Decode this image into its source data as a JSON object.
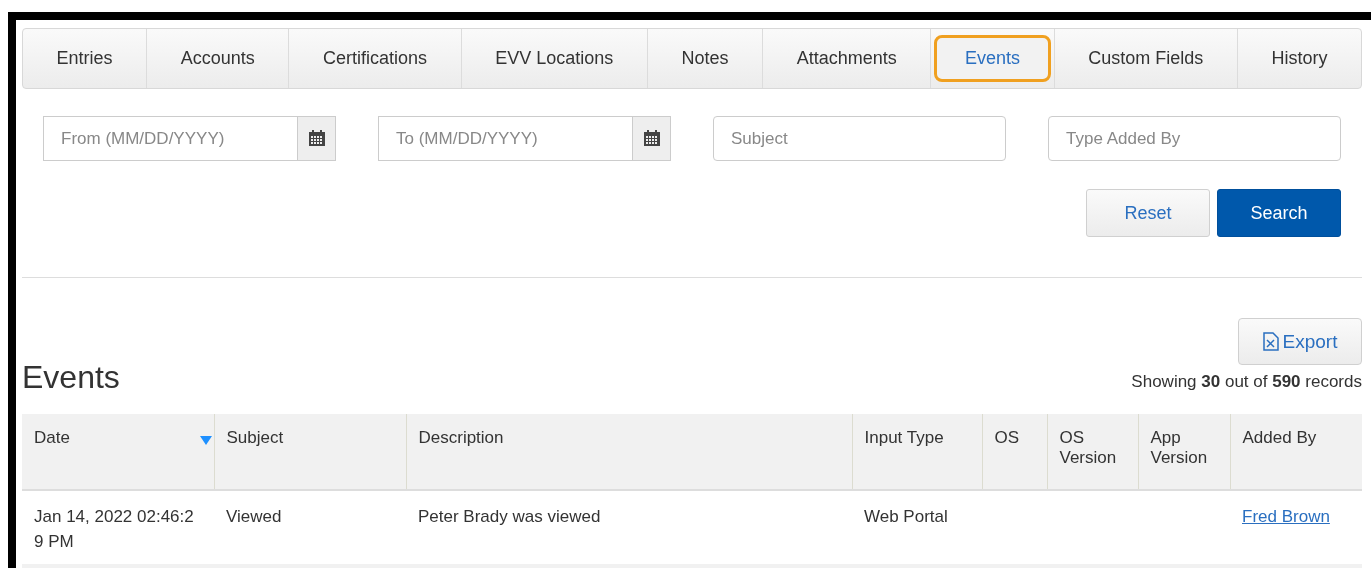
{
  "tabs": [
    {
      "label": "Entries",
      "selected": false
    },
    {
      "label": "Accounts",
      "selected": false
    },
    {
      "label": "Certifications",
      "selected": false
    },
    {
      "label": "EVV Locations",
      "selected": false
    },
    {
      "label": "Notes",
      "selected": false
    },
    {
      "label": "Attachments",
      "selected": false
    },
    {
      "label": "Events",
      "selected": true
    },
    {
      "label": "Custom Fields",
      "selected": false
    },
    {
      "label": "History",
      "selected": false
    }
  ],
  "filters": [
    {
      "kind": "date",
      "placeholder": "From (MM/DD/YYYY)"
    },
    {
      "kind": "date",
      "placeholder": "To (MM/DD/YYYY)"
    },
    {
      "kind": "text",
      "placeholder": "Subject"
    },
    {
      "kind": "text",
      "placeholder": "Type Added By"
    }
  ],
  "buttons": [
    {
      "label": "Reset",
      "kind": "default"
    },
    {
      "label": "Search",
      "kind": "primary"
    }
  ],
  "export_button": "Export",
  "heading": "Events",
  "record_count": "Showing **30** out of **590** records",
  "table": {
    "columns": [
      {
        "label": "Date",
        "sorted": true
      },
      {
        "label": "Subject",
        "sorted": false
      },
      {
        "label": "Description",
        "sorted": false
      },
      {
        "label": "Input Type",
        "sorted": false
      },
      {
        "label": "OS",
        "sorted": false
      },
      {
        "label": "OS Version",
        "sorted": false
      },
      {
        "label": "App Version",
        "sorted": false
      },
      {
        "label": "Added By",
        "sorted": false
      }
    ],
    "rows": [
      {
        "cells": [
          "Jan 14, 2022 02:46:29 PM",
          "Viewed",
          "Peter Brady was viewed",
          "Web Portal",
          "",
          "",
          "",
          "Fred Brown"
        ]
      }
    ]
  }
}
